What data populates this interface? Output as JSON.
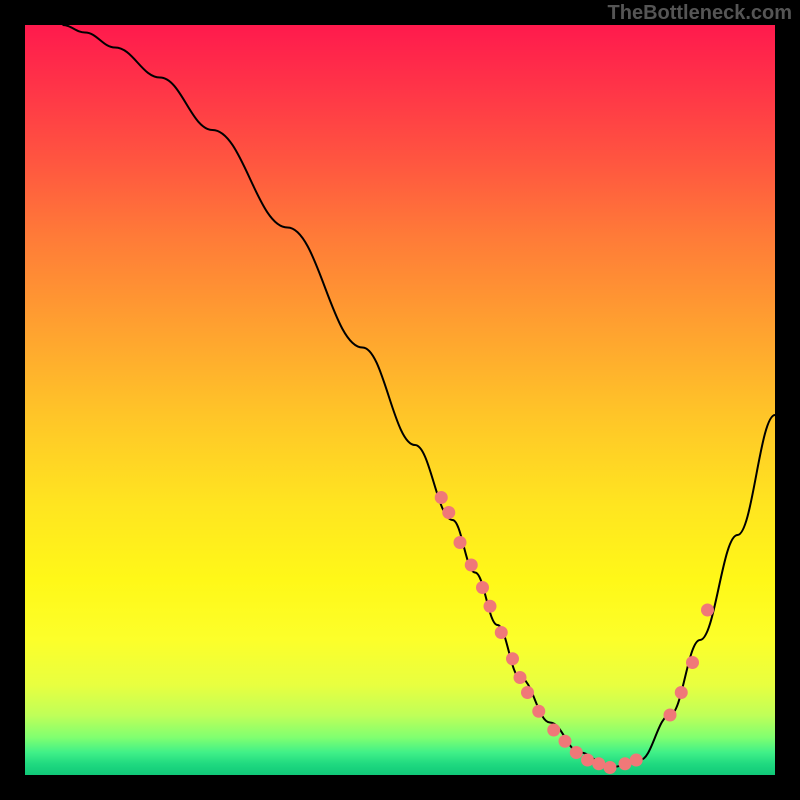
{
  "watermark": "TheBottleneck.com",
  "chart_data": {
    "type": "line",
    "title": "",
    "xlabel": "",
    "ylabel": "",
    "xlim": [
      0,
      100
    ],
    "ylim": [
      0,
      100
    ],
    "curve": {
      "x": [
        5,
        8,
        12,
        18,
        25,
        35,
        45,
        52,
        57,
        60,
        63,
        66,
        70,
        74,
        78,
        82,
        86,
        90,
        95,
        100
      ],
      "y": [
        100,
        99,
        97,
        93,
        86,
        73,
        57,
        44,
        34,
        27,
        20,
        13,
        7,
        3,
        1,
        2,
        8,
        18,
        32,
        48
      ]
    },
    "markers": {
      "x": [
        55.5,
        56.5,
        58,
        59.5,
        61,
        62,
        63.5,
        65,
        66,
        67,
        68.5,
        70.5,
        72,
        73.5,
        75,
        76.5,
        78,
        80,
        81.5,
        86,
        87.5,
        89,
        91
      ],
      "y": [
        37,
        35,
        31,
        28,
        25,
        22.5,
        19,
        15.5,
        13,
        11,
        8.5,
        6,
        4.5,
        3,
        2,
        1.5,
        1,
        1.5,
        2,
        8,
        11,
        15,
        22
      ]
    },
    "marker_color": "#f07878",
    "line_color": "#000000"
  }
}
